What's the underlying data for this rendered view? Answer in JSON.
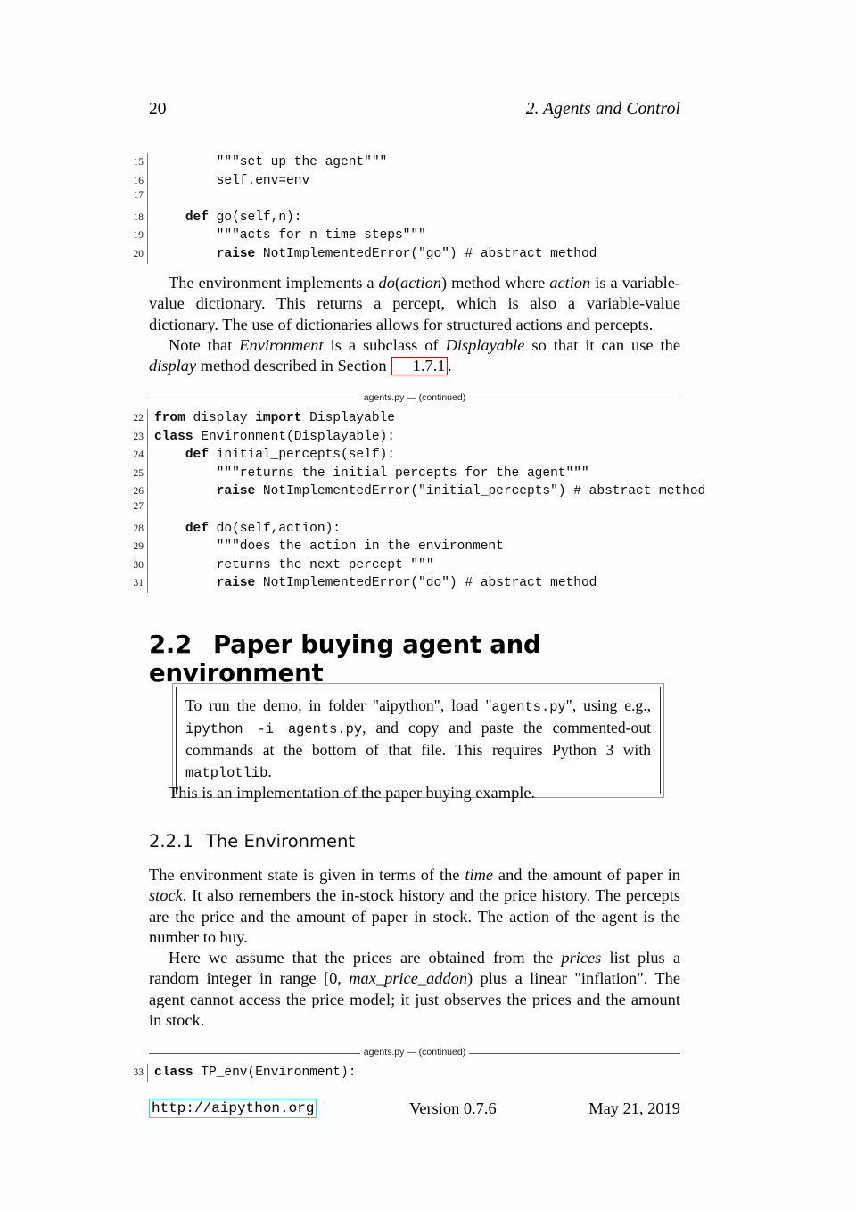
{
  "header": {
    "page_number": "20",
    "chapter_title": "2.  Agents and Control"
  },
  "listing_top": {
    "lines": [
      {
        "no": "15",
        "parts": [
          {
            "t": "        \"\"\"set up the agent\"\"\"",
            "kw": false
          }
        ]
      },
      {
        "no": "16",
        "parts": [
          {
            "t": "        self.env=env",
            "kw": false
          }
        ]
      },
      {
        "no": "17",
        "parts": [
          {
            "t": "",
            "kw": false
          }
        ]
      },
      {
        "no": "18",
        "parts": [
          {
            "t": "    ",
            "kw": false
          },
          {
            "t": "def",
            "kw": true
          },
          {
            "t": " go(self,n):",
            "kw": false
          }
        ]
      },
      {
        "no": "19",
        "parts": [
          {
            "t": "        \"\"\"acts for n time steps\"\"\"",
            "kw": false
          }
        ]
      },
      {
        "no": "20",
        "parts": [
          {
            "t": "        ",
            "kw": false
          },
          {
            "t": "raise",
            "kw": true
          },
          {
            "t": " NotImplementedError(\"go\") # abstract method",
            "kw": false
          }
        ]
      }
    ]
  },
  "para1": {
    "seg": [
      {
        "t": "The environment implements a ",
        "style": "normal"
      },
      {
        "t": "do",
        "style": "italic"
      },
      {
        "t": "(",
        "style": "normal"
      },
      {
        "t": "action",
        "style": "italic"
      },
      {
        "t": ") method where ",
        "style": "normal"
      },
      {
        "t": "action",
        "style": "italic"
      },
      {
        "t": " is a variable-value dictionary. This returns a percept, which is also a variable-value dictionary. The use of dictionaries allows for structured actions and percepts.",
        "style": "normal"
      }
    ]
  },
  "para2": {
    "seg": [
      {
        "t": "Note that ",
        "style": "normal"
      },
      {
        "t": "Environment",
        "style": "italic"
      },
      {
        "t": " is a subclass of ",
        "style": "normal"
      },
      {
        "t": "Displayable",
        "style": "italic"
      },
      {
        "t": " so that it can use the ",
        "style": "normal"
      },
      {
        "t": "display",
        "style": "italic"
      },
      {
        "t": " method described in Section ",
        "style": "normal"
      },
      {
        "t": "1.7.1",
        "style": "xref"
      },
      {
        "t": ".",
        "style": "normal"
      }
    ]
  },
  "listing_caption_1": "agents.py — (continued)",
  "listing_mid": {
    "lines": [
      {
        "no": "22",
        "parts": [
          {
            "t": "from",
            "kw": true
          },
          {
            "t": " display ",
            "kw": false
          },
          {
            "t": "import",
            "kw": true
          },
          {
            "t": " Displayable",
            "kw": false
          }
        ]
      },
      {
        "no": "23",
        "parts": [
          {
            "t": "class",
            "kw": true
          },
          {
            "t": " Environment(Displayable):",
            "kw": false
          }
        ]
      },
      {
        "no": "24",
        "parts": [
          {
            "t": "    ",
            "kw": false
          },
          {
            "t": "def",
            "kw": true
          },
          {
            "t": " initial_percepts(self):",
            "kw": false
          }
        ]
      },
      {
        "no": "25",
        "parts": [
          {
            "t": "        \"\"\"returns the initial percepts for the agent\"\"\"",
            "kw": false
          }
        ]
      },
      {
        "no": "26",
        "parts": [
          {
            "t": "        ",
            "kw": false
          },
          {
            "t": "raise",
            "kw": true
          },
          {
            "t": " NotImplementedError(\"initial_percepts\") # abstract method",
            "kw": false
          }
        ]
      },
      {
        "no": "27",
        "parts": [
          {
            "t": "",
            "kw": false
          }
        ]
      },
      {
        "no": "28",
        "parts": [
          {
            "t": "    ",
            "kw": false
          },
          {
            "t": "def",
            "kw": true
          },
          {
            "t": " do(self,action):",
            "kw": false
          }
        ]
      },
      {
        "no": "29",
        "parts": [
          {
            "t": "        \"\"\"does the action in the environment",
            "kw": false
          }
        ]
      },
      {
        "no": "30",
        "parts": [
          {
            "t": "        returns the next percept \"\"\"",
            "kw": false
          }
        ]
      },
      {
        "no": "31",
        "parts": [
          {
            "t": "        ",
            "kw": false
          },
          {
            "t": "raise",
            "kw": true
          },
          {
            "t": " NotImplementedError(\"do\") # abstract method",
            "kw": false
          }
        ]
      }
    ]
  },
  "section": {
    "number": "2.2",
    "title": "Paper buying agent and environment"
  },
  "demo_box": {
    "seg": [
      {
        "t": "To run the demo, in folder \"aipython\", load \"",
        "style": "normal"
      },
      {
        "t": "agents.py",
        "style": "mono"
      },
      {
        "t": "\", using e.g., ",
        "style": "normal"
      },
      {
        "t": "ipython  -i  agents.py",
        "style": "mono"
      },
      {
        "t": ", and copy and paste the commented-out commands at the bottom of that file.  This requires Python 3 with ",
        "style": "normal"
      },
      {
        "t": "matplotlib",
        "style": "mono"
      },
      {
        "t": ".",
        "style": "normal"
      }
    ]
  },
  "para3": {
    "seg": [
      {
        "t": "This is an implementation of the paper buying example.",
        "style": "normal"
      }
    ]
  },
  "subsection": {
    "number": "2.2.1",
    "title": "The Environment"
  },
  "para4": {
    "seg": [
      {
        "t": "The environment state is given in terms of the ",
        "style": "normal"
      },
      {
        "t": "time",
        "style": "italic"
      },
      {
        "t": " and the amount of paper in ",
        "style": "normal"
      },
      {
        "t": "stock",
        "style": "italic"
      },
      {
        "t": ". It also remembers the in-stock history and the price history. The percepts are the price and the amount of paper in stock. The action of the agent is the number to buy.",
        "style": "normal"
      }
    ]
  },
  "para5": {
    "seg": [
      {
        "t": "Here we assume that the prices are obtained from the ",
        "style": "normal"
      },
      {
        "t": "prices",
        "style": "italic"
      },
      {
        "t": " list plus a random integer in range [0, ",
        "style": "normal"
      },
      {
        "t": "max_price_addon",
        "style": "italic"
      },
      {
        "t": ") plus a linear \"inflation\". The agent cannot access the price model; it just observes the prices and the amount in stock.",
        "style": "normal"
      }
    ]
  },
  "listing_caption_2": "agents.py — (continued)",
  "listing_bottom": {
    "lines": [
      {
        "no": "33",
        "parts": [
          {
            "t": "class",
            "kw": true
          },
          {
            "t": " TP_env(Environment):",
            "kw": false
          }
        ]
      }
    ]
  },
  "footer": {
    "link": "http://aipython.org",
    "version": "Version 0.7.6",
    "date": "May 21, 2019",
    "link_border_color": "#00e5ff"
  }
}
